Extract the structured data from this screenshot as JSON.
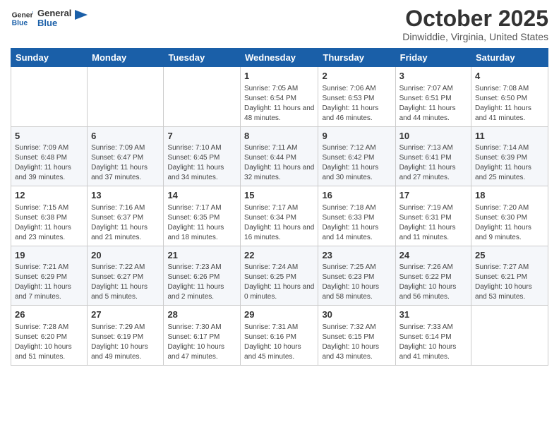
{
  "header": {
    "logo_line1": "General",
    "logo_line2": "Blue",
    "month": "October 2025",
    "location": "Dinwiddie, Virginia, United States"
  },
  "weekdays": [
    "Sunday",
    "Monday",
    "Tuesday",
    "Wednesday",
    "Thursday",
    "Friday",
    "Saturday"
  ],
  "weeks": [
    [
      {
        "day": "",
        "info": ""
      },
      {
        "day": "",
        "info": ""
      },
      {
        "day": "",
        "info": ""
      },
      {
        "day": "1",
        "info": "Sunrise: 7:05 AM\nSunset: 6:54 PM\nDaylight: 11 hours and 48 minutes."
      },
      {
        "day": "2",
        "info": "Sunrise: 7:06 AM\nSunset: 6:53 PM\nDaylight: 11 hours and 46 minutes."
      },
      {
        "day": "3",
        "info": "Sunrise: 7:07 AM\nSunset: 6:51 PM\nDaylight: 11 hours and 44 minutes."
      },
      {
        "day": "4",
        "info": "Sunrise: 7:08 AM\nSunset: 6:50 PM\nDaylight: 11 hours and 41 minutes."
      }
    ],
    [
      {
        "day": "5",
        "info": "Sunrise: 7:09 AM\nSunset: 6:48 PM\nDaylight: 11 hours and 39 minutes."
      },
      {
        "day": "6",
        "info": "Sunrise: 7:09 AM\nSunset: 6:47 PM\nDaylight: 11 hours and 37 minutes."
      },
      {
        "day": "7",
        "info": "Sunrise: 7:10 AM\nSunset: 6:45 PM\nDaylight: 11 hours and 34 minutes."
      },
      {
        "day": "8",
        "info": "Sunrise: 7:11 AM\nSunset: 6:44 PM\nDaylight: 11 hours and 32 minutes."
      },
      {
        "day": "9",
        "info": "Sunrise: 7:12 AM\nSunset: 6:42 PM\nDaylight: 11 hours and 30 minutes."
      },
      {
        "day": "10",
        "info": "Sunrise: 7:13 AM\nSunset: 6:41 PM\nDaylight: 11 hours and 27 minutes."
      },
      {
        "day": "11",
        "info": "Sunrise: 7:14 AM\nSunset: 6:39 PM\nDaylight: 11 hours and 25 minutes."
      }
    ],
    [
      {
        "day": "12",
        "info": "Sunrise: 7:15 AM\nSunset: 6:38 PM\nDaylight: 11 hours and 23 minutes."
      },
      {
        "day": "13",
        "info": "Sunrise: 7:16 AM\nSunset: 6:37 PM\nDaylight: 11 hours and 21 minutes."
      },
      {
        "day": "14",
        "info": "Sunrise: 7:17 AM\nSunset: 6:35 PM\nDaylight: 11 hours and 18 minutes."
      },
      {
        "day": "15",
        "info": "Sunrise: 7:17 AM\nSunset: 6:34 PM\nDaylight: 11 hours and 16 minutes."
      },
      {
        "day": "16",
        "info": "Sunrise: 7:18 AM\nSunset: 6:33 PM\nDaylight: 11 hours and 14 minutes."
      },
      {
        "day": "17",
        "info": "Sunrise: 7:19 AM\nSunset: 6:31 PM\nDaylight: 11 hours and 11 minutes."
      },
      {
        "day": "18",
        "info": "Sunrise: 7:20 AM\nSunset: 6:30 PM\nDaylight: 11 hours and 9 minutes."
      }
    ],
    [
      {
        "day": "19",
        "info": "Sunrise: 7:21 AM\nSunset: 6:29 PM\nDaylight: 11 hours and 7 minutes."
      },
      {
        "day": "20",
        "info": "Sunrise: 7:22 AM\nSunset: 6:27 PM\nDaylight: 11 hours and 5 minutes."
      },
      {
        "day": "21",
        "info": "Sunrise: 7:23 AM\nSunset: 6:26 PM\nDaylight: 11 hours and 2 minutes."
      },
      {
        "day": "22",
        "info": "Sunrise: 7:24 AM\nSunset: 6:25 PM\nDaylight: 11 hours and 0 minutes."
      },
      {
        "day": "23",
        "info": "Sunrise: 7:25 AM\nSunset: 6:23 PM\nDaylight: 10 hours and 58 minutes."
      },
      {
        "day": "24",
        "info": "Sunrise: 7:26 AM\nSunset: 6:22 PM\nDaylight: 10 hours and 56 minutes."
      },
      {
        "day": "25",
        "info": "Sunrise: 7:27 AM\nSunset: 6:21 PM\nDaylight: 10 hours and 53 minutes."
      }
    ],
    [
      {
        "day": "26",
        "info": "Sunrise: 7:28 AM\nSunset: 6:20 PM\nDaylight: 10 hours and 51 minutes."
      },
      {
        "day": "27",
        "info": "Sunrise: 7:29 AM\nSunset: 6:19 PM\nDaylight: 10 hours and 49 minutes."
      },
      {
        "day": "28",
        "info": "Sunrise: 7:30 AM\nSunset: 6:17 PM\nDaylight: 10 hours and 47 minutes."
      },
      {
        "day": "29",
        "info": "Sunrise: 7:31 AM\nSunset: 6:16 PM\nDaylight: 10 hours and 45 minutes."
      },
      {
        "day": "30",
        "info": "Sunrise: 7:32 AM\nSunset: 6:15 PM\nDaylight: 10 hours and 43 minutes."
      },
      {
        "day": "31",
        "info": "Sunrise: 7:33 AM\nSunset: 6:14 PM\nDaylight: 10 hours and 41 minutes."
      },
      {
        "day": "",
        "info": ""
      }
    ]
  ]
}
